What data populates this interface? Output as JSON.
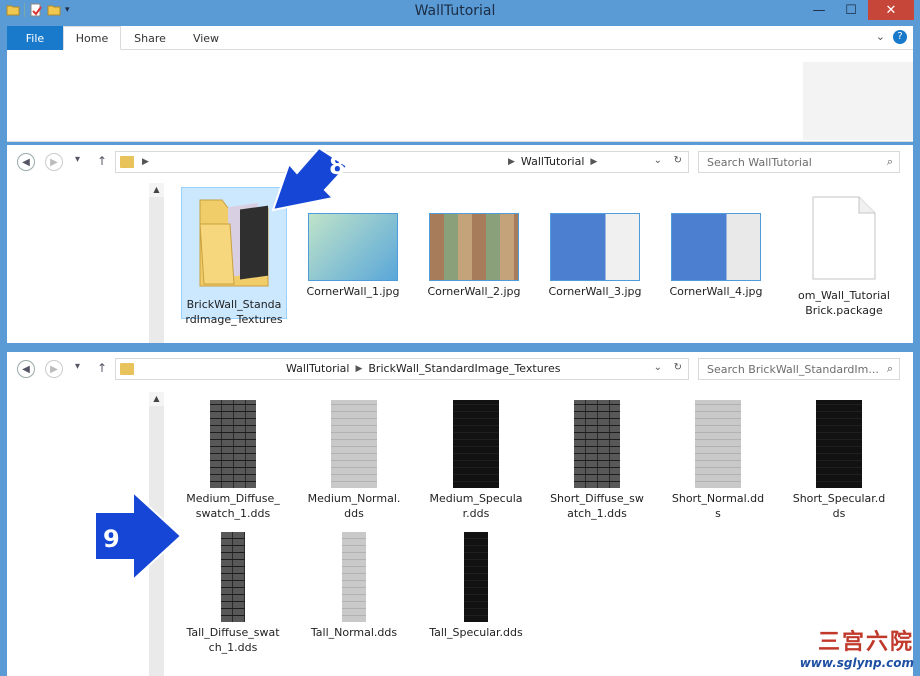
{
  "window": {
    "title": "WallTutorial",
    "minimize": "—",
    "maximize": "☐",
    "close": "✕"
  },
  "ribbon": {
    "tabs": {
      "file": "File",
      "home": "Home",
      "share": "Share",
      "view": "View"
    },
    "collapse": "⌄",
    "help": "?"
  },
  "pane1": {
    "crumbs": [
      "WallTutorial"
    ],
    "search_placeholder": "Search WallTutorial",
    "items": [
      "BrickWall_Standa\nrdImage_Textures",
      "CornerWall_1.jpg",
      "CornerWall_2.jpg",
      "CornerWall_3.jpg",
      "CornerWall_4.jpg",
      "om_Wall_Tutorial\nBrick.package"
    ]
  },
  "pane2": {
    "crumbs": [
      "WallTutorial",
      "BrickWall_StandardImage_Textures"
    ],
    "search_placeholder": "Search BrickWall_StandardIm...",
    "items": [
      "Medium_Diffuse_\nswatch_1.dds",
      "Medium_Normal.\ndds",
      "Medium_Specula\nr.dds",
      "Short_Diffuse_sw\natch_1.dds",
      "Short_Normal.dd\ns",
      "Short_Specular.d\nds",
      "Tall_Diffuse_swat\nch_1.dds",
      "Tall_Normal.dds",
      "Tall_Specular.dds"
    ]
  },
  "annotations": {
    "step8": "8",
    "step9": "9"
  },
  "watermark": {
    "cn": "三宫六院",
    "url": "www.sglynp.com"
  },
  "colors": {
    "accent": "#1979ca",
    "arrow": "#1646d6",
    "titlebar": "#5b9bd5"
  }
}
